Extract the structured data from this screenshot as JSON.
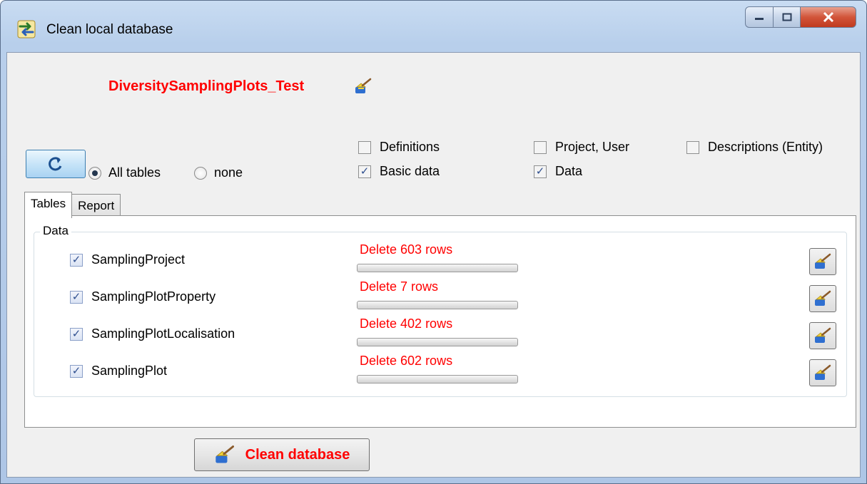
{
  "window": {
    "title": "Clean local database",
    "icon": "transfer-arrows-icon",
    "caption_buttons": {
      "minimize": "minimize-icon",
      "maximize": "maximize-icon",
      "close": "close-icon"
    }
  },
  "header": {
    "database_name": "DiversitySamplingPlots_Test",
    "database_icon": "broom-icon"
  },
  "selection": {
    "refresh_icon": "refresh-icon",
    "radio_all": {
      "label": "All tables",
      "selected": true
    },
    "radio_none": {
      "label": "none",
      "selected": false
    }
  },
  "filters": {
    "definitions": {
      "label": "Definitions",
      "checked": false
    },
    "basic_data": {
      "label": "Basic data",
      "checked": true
    },
    "project_user": {
      "label": "Project, User",
      "checked": false
    },
    "data": {
      "label": "Data",
      "checked": true
    },
    "descriptions_entity": {
      "label": "Descriptions (Entity)",
      "checked": false
    }
  },
  "tabs": [
    {
      "label": "Tables",
      "active": true
    },
    {
      "label": "Report",
      "active": false
    }
  ],
  "group": {
    "label": "Data",
    "rows": [
      {
        "table": "SamplingProject",
        "checked": true,
        "delete_text": "Delete 603 rows",
        "progress": 0
      },
      {
        "table": "SamplingPlotProperty",
        "checked": true,
        "delete_text": "Delete 7 rows",
        "progress": 0
      },
      {
        "table": "SamplingPlotLocalisation",
        "checked": true,
        "delete_text": "Delete 402 rows",
        "progress": 0
      },
      {
        "table": "SamplingPlot",
        "checked": true,
        "delete_text": "Delete 602 rows",
        "progress": 0
      }
    ]
  },
  "footer": {
    "clean_button_label": "Clean database"
  },
  "colors": {
    "accent_red": "#ff0000",
    "check_blue": "#2f4f8f"
  }
}
